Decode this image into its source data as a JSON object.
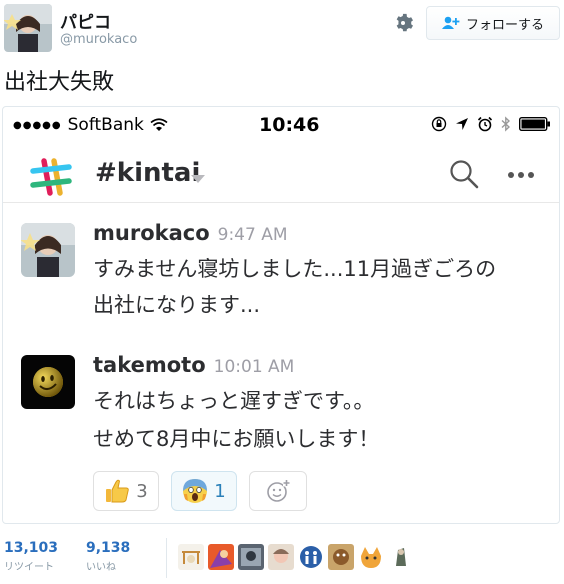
{
  "tweet": {
    "display_name": "パピコ",
    "handle": "@murokaco",
    "follow_label": "フォローする",
    "text": "出社大失敗"
  },
  "phone": {
    "carrier": "SoftBank",
    "time": "10:46",
    "channel": "#kintai"
  },
  "messages": [
    {
      "author": "murokaco",
      "time": "9:47 AM",
      "lines": [
        "すみません寝坊しました...11月過ぎごろの",
        "出社になります..."
      ]
    },
    {
      "author": "takemoto",
      "time": "10:01 AM",
      "lines": [
        "それはちょっと遅すぎです。。",
        "せめて8月中にお願いします！"
      ]
    }
  ],
  "reactions": [
    {
      "icon": "thumbs-up",
      "count": "3"
    },
    {
      "icon": "screaming-face",
      "count": "1"
    }
  ],
  "stats": {
    "retweets": "13,103",
    "retweets_label": "リツイート",
    "likes": "9,138",
    "likes_label": "いいね"
  },
  "colors": {
    "link_blue": "#2a6ebd",
    "slack_text": "#2c2d30",
    "muted": "#8899a6"
  }
}
